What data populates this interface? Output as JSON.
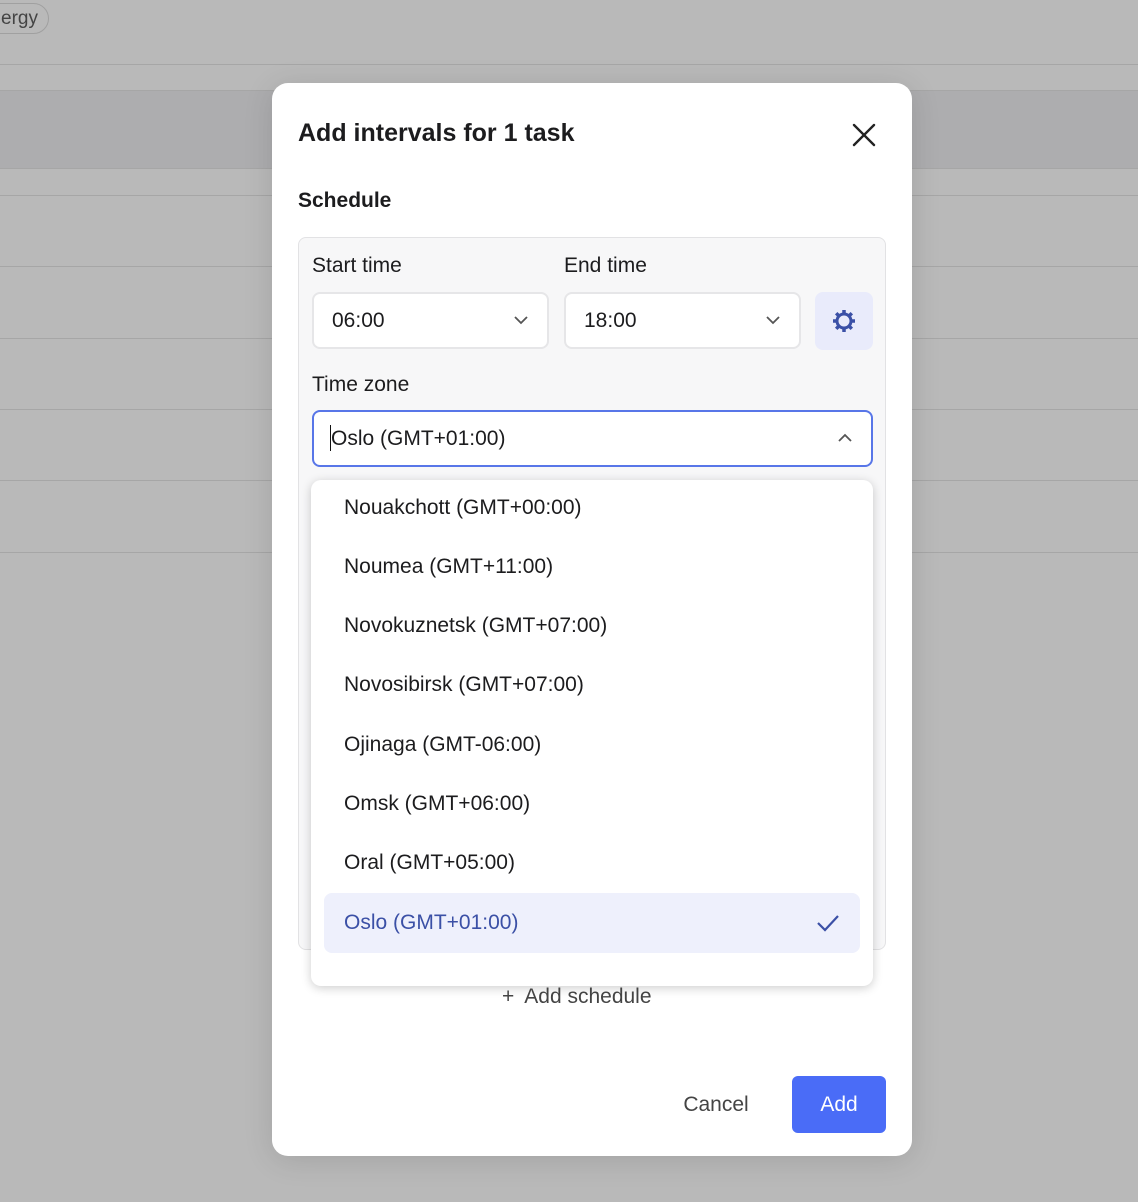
{
  "background": {
    "chip_label": "ergy"
  },
  "modal": {
    "title": "Add intervals for 1 task",
    "section_label": "Schedule",
    "start_time": {
      "label": "Start time",
      "value": "06:00"
    },
    "end_time": {
      "label": "End time",
      "value": "18:00"
    },
    "time_zone": {
      "label": "Time zone",
      "value": "Oslo (GMT+01:00)"
    },
    "options": [
      {
        "label": "Nouakchott (GMT+00:00)"
      },
      {
        "label": "Noumea (GMT+11:00)"
      },
      {
        "label": "Novokuznetsk (GMT+07:00)"
      },
      {
        "label": "Novosibirsk (GMT+07:00)"
      },
      {
        "label": "Ojinaga (GMT-06:00)"
      },
      {
        "label": "Omsk (GMT+06:00)"
      },
      {
        "label": "Oral (GMT+05:00)"
      },
      {
        "label": "Oslo (GMT+01:00)",
        "selected": true
      }
    ],
    "add_schedule": "Add schedule",
    "cancel": "Cancel",
    "add": "Add"
  },
  "colors": {
    "accent": "#4a6cf7",
    "selected_bg": "#eef0fc",
    "selected_text": "#3b50a6"
  }
}
